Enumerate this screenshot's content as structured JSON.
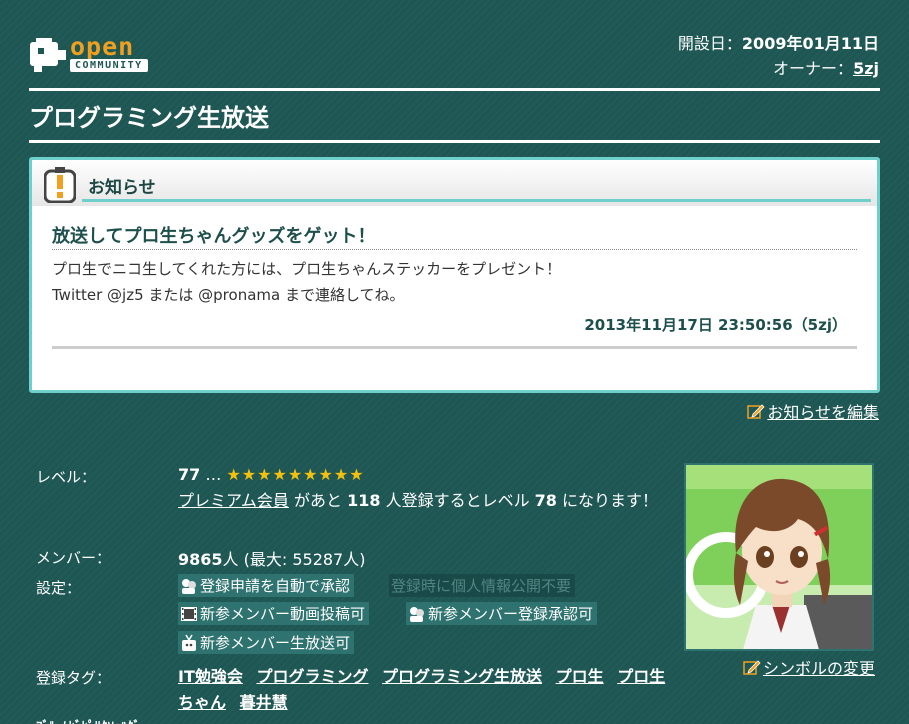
{
  "logo": {
    "open_text": "open",
    "community_text": "COMMUNITY"
  },
  "meta": {
    "founded_label": "開設日：",
    "founded_date": "2009年01月11日",
    "owner_label": "オーナー：",
    "owner_name": "5zj"
  },
  "page_title": "プログラミング生放送",
  "notice": {
    "label": "お知らせ",
    "title": "放送してプロ生ちゃんグッズをゲット！",
    "line1": "プロ生でニコ生してくれた方には、プロ生ちゃんステッカーをプレゼント！",
    "line2": "Twitter @jz5 または @pronama まで連絡してね。",
    "date": "2013年11月17日 23:50:56（5zj）",
    "edit_link": "お知らせを編集"
  },
  "info": {
    "level_label": "レベル：",
    "level_value": "77",
    "level_ellipsis": "…",
    "stars": "★★★★★★★★★",
    "premium_link": "プレミアム会員",
    "level_desc_1": " があと ",
    "level_remaining": "118",
    "level_desc_2": " 人登録するとレベル ",
    "level_next": "78",
    "level_desc_3": " になります！",
    "members_label": "メンバー：",
    "members_count": "9865",
    "members_unit": "人 (最大: 55287人)",
    "settings_label": "設定：",
    "settings": [
      "登録申請を自動で承認",
      "登録時に個人情報公開不要",
      "新参メンバー動画投稿可",
      "新参メンバー登録承認可",
      "新参メンバー生放送可"
    ],
    "tags_label": "登録タグ：",
    "tags": [
      "IT勉強会",
      "プログラミング",
      "プログラミング生放送",
      "プロ生",
      "プロ生ちゃん",
      "暮井慧"
    ],
    "symbol_link": "シンボルの変更",
    "cut_text": "ﾌﾞﾙｰﾑﾋﾞﾋﾟﾘｸｿｯﾊｸﾞ"
  },
  "colors": {
    "background": "#1d5653",
    "accent": "#6fcfcb",
    "stars": "#f3c010",
    "badge": "#2e7370"
  }
}
